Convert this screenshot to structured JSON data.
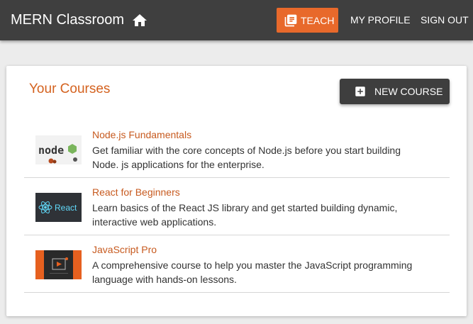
{
  "appbar": {
    "title": "MERN Classroom",
    "home_icon": "home-icon",
    "teach_label": "TEACH",
    "teach_icon": "library-books-icon",
    "nav": {
      "profile": "MY PROFILE",
      "signout": "SIGN OUT"
    }
  },
  "colors": {
    "appbar_bg": "#3f3f3f",
    "accent": "#e8692b",
    "title_orange": "#d4621f",
    "button_dark": "#3e3e3e"
  },
  "card": {
    "title": "Your Courses",
    "new_course_label": "NEW COURSE",
    "new_course_icon": "add-box-icon"
  },
  "courses": [
    {
      "name": "Node.js Fundamentals",
      "description": "Get familiar with the core concepts of Node.js before you start building Node. js applications for the enterprise.",
      "thumb_text": "node"
    },
    {
      "name": "React for Beginners",
      "description": "Learn basics of the React JS library and get started building dynamic, interactive web applications.",
      "thumb_text": "React"
    },
    {
      "name": "JavaScript Pro",
      "description": "A comprehensive course to help you master the JavaScript programming language with hands-on lessons.",
      "thumb_text": ""
    }
  ]
}
